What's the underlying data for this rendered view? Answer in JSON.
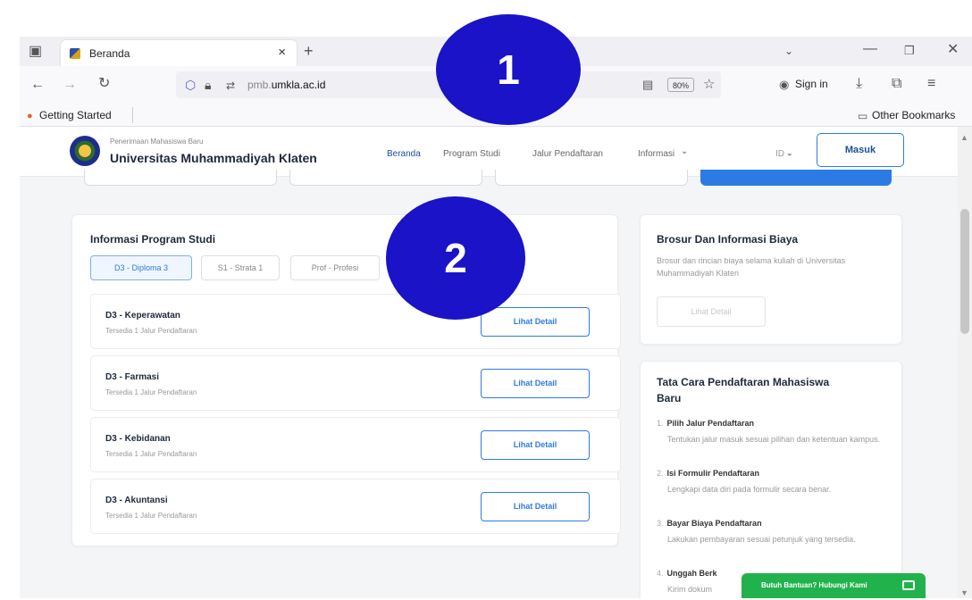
{
  "browser": {
    "tab_title": "Beranda",
    "tab_close": "×",
    "new_tab": "+",
    "url_host_prefix": "pmb.",
    "url_host_main": "umkla.ac.id",
    "zoom": "80%",
    "sign_in": "Sign in",
    "bookmark_getting_started": "Getting Started",
    "bookmark_other": "Other Bookmarks"
  },
  "site": {
    "brand_subtitle": "Penerimaan Mahasiswa Baru",
    "brand_title": "Universitas Muhammadiyah Klaten",
    "nav": [
      "Beranda",
      "Program Studi",
      "Jalur Pendaftaran",
      "Informasi"
    ],
    "nav_dropdown_caret": "⌄",
    "lang": "ID",
    "login_label": "Masuk"
  },
  "programs": {
    "title": "Informasi Program Studi",
    "tabs": [
      "D3 - Diploma 3",
      "S1 - Strata 1",
      "Prof - Profesi"
    ],
    "items": [
      {
        "name": "D3 - Keperawatan",
        "sub": "Tersedia 1 Jalur Pendaftaran",
        "button": "Lihat Detail"
      },
      {
        "name": "D3 - Farmasi",
        "sub": "Tersedia 1 Jalur Pendaftaran",
        "button": "Lihat Detail"
      },
      {
        "name": "D3 - Kebidanan",
        "sub": "Tersedia 1 Jalur Pendaftaran",
        "button": "Lihat Detail"
      },
      {
        "name": "D3 - Akuntansi",
        "sub": "Tersedia 1 Jalur Pendaftaran",
        "button": "Lihat Detail"
      }
    ]
  },
  "brochure": {
    "title": "Brosur Dan Informasi Biaya",
    "desc": "Brosur dan rincian biaya selama kuliah di Universitas Muhammadiyah Klaten",
    "button": "Lihat Detail"
  },
  "steps": {
    "title_line1": "Tata Cara Pendaftaran Mahasiswa",
    "title_line2": "Baru",
    "items": [
      {
        "num": "1.",
        "title": "Pilih Jalur Pendaftaran",
        "desc": "Tentukan jalur masuk sesuai pilihan dan ketentuan kampus."
      },
      {
        "num": "2.",
        "title": "Isi Formulir Pendaftaran",
        "desc": "Lengkapi data diri pada formulir secara benar."
      },
      {
        "num": "3.",
        "title": "Bayar Biaya Pendaftaran",
        "desc": "Lakukan pembayaran sesuai petunjuk yang tersedia."
      },
      {
        "num": "4.",
        "title": "Unggah Berk",
        "desc": "Kirim dokum"
      }
    ]
  },
  "help_button": "Butuh Bantuan? Hubungi Kami",
  "badges": [
    "1",
    "2"
  ],
  "colors": {
    "primary": "#2c7be5",
    "badge": "#1a13c8",
    "help": "#22b24c"
  }
}
